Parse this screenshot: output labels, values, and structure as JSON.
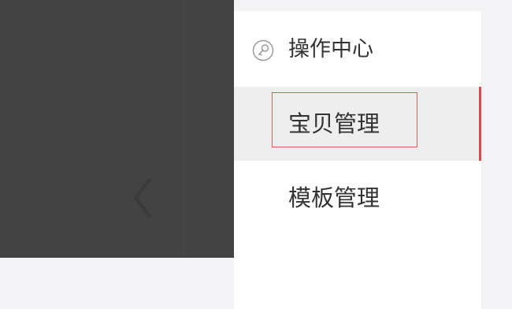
{
  "sidebar": {
    "collapse_icon": "chevron-left-icon",
    "header": {
      "icon": "key-icon",
      "label": "操作中心"
    },
    "items": [
      {
        "label": "宝贝管理",
        "active": true
      },
      {
        "label": "模板管理",
        "active": false
      },
      {
        "label": "",
        "active": false
      }
    ]
  },
  "colors": {
    "dark_panel": "#434343",
    "menu_background": "#ffffff",
    "active_item_background": "#eeeeee",
    "active_indicator": "#d94a4a",
    "highlight_box": "#e35c5c",
    "text": "#333333"
  }
}
